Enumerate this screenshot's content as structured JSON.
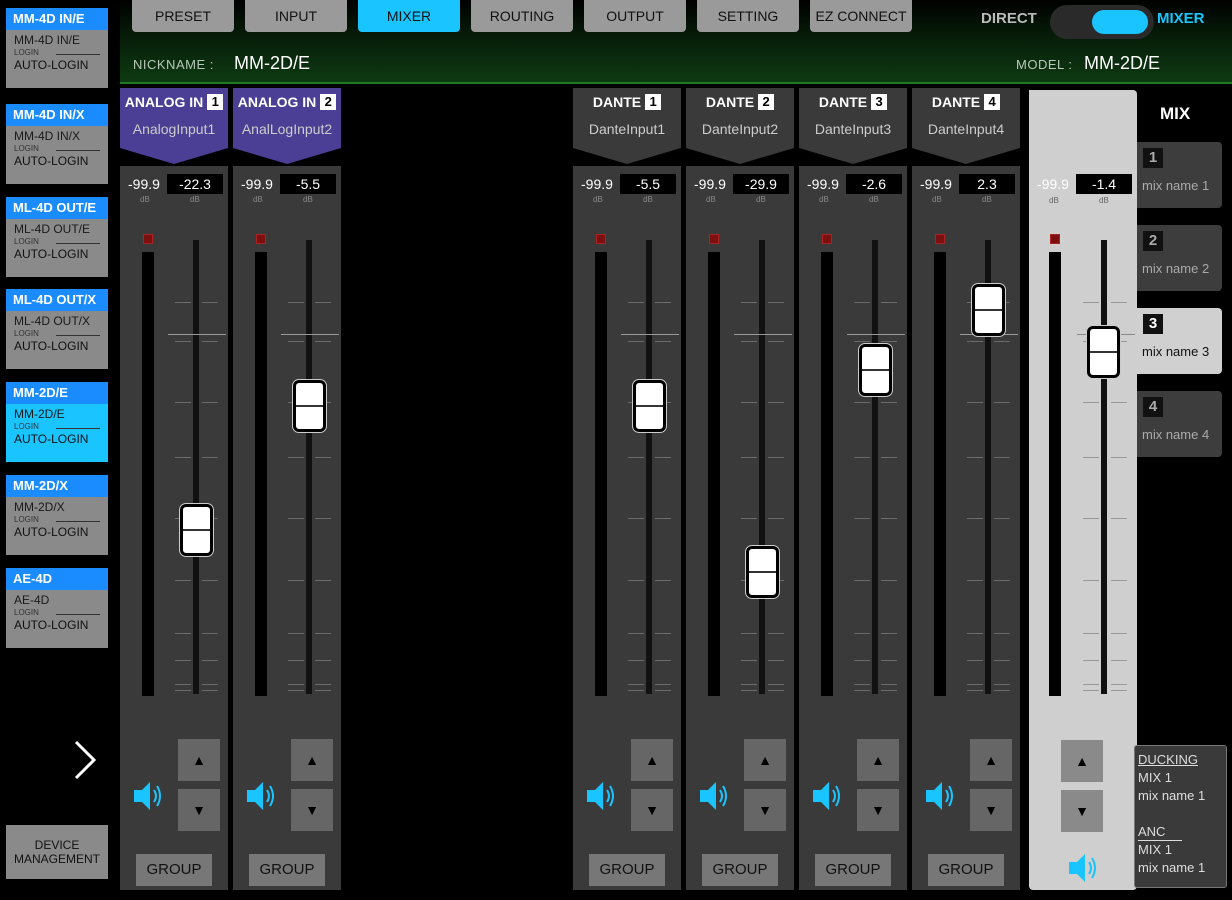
{
  "sidebar": {
    "devices": [
      {
        "title": "MM-4D IN/E",
        "name": "MM-4D IN/E",
        "login": "LOGIN",
        "auto": "AUTO-LOGIN"
      },
      {
        "title": "MM-4D IN/X",
        "name": "MM-4D IN/X",
        "login": "LOGIN",
        "auto": "AUTO-LOGIN"
      },
      {
        "title": "ML-4D OUT/E",
        "name": "ML-4D OUT/E",
        "login": "LOGIN",
        "auto": "AUTO-LOGIN"
      },
      {
        "title": "ML-4D OUT/X",
        "name": "ML-4D OUT/X",
        "login": "LOGIN",
        "auto": "AUTO-LOGIN"
      },
      {
        "title": "MM-2D/E",
        "name": "MM-2D/E",
        "login": "LOGIN",
        "auto": "AUTO-LOGIN"
      },
      {
        "title": "MM-2D/X",
        "name": "MM-2D/X",
        "login": "LOGIN",
        "auto": "AUTO-LOGIN"
      },
      {
        "title": "AE-4D",
        "name": "AE-4D",
        "login": "LOGIN",
        "auto": "AUTO-LOGIN"
      }
    ],
    "next_icon": "chevron-right-icon",
    "device_management": "DEVICE MANAGEMENT"
  },
  "header": {
    "tabs": [
      "PRESET",
      "INPUT",
      "MIXER",
      "ROUTING",
      "OUTPUT",
      "SETTING",
      "EZ CONNECT"
    ],
    "active_tab": "MIXER",
    "toggle_left": "DIRECT",
    "toggle_right": "MIXER",
    "nickname_label": "NICKNAME :",
    "nickname_value": "MM-2D/E",
    "model_label": "MODEL :",
    "model_value": "MM-2D/E"
  },
  "channels": [
    {
      "type": "ANALOG IN",
      "num": "1",
      "name": "AnalogInput1",
      "peak": "-99.9",
      "gain": "-22.3",
      "db": "dB",
      "group": "GROUP"
    },
    {
      "type": "ANALOG IN",
      "num": "2",
      "name": "AnalLogInput2",
      "peak": "-99.9",
      "gain": "-5.5",
      "db": "dB",
      "group": "GROUP"
    },
    {
      "type": "DANTE",
      "num": "1",
      "name": "DanteInput1",
      "peak": "-99.9",
      "gain": "-5.5",
      "db": "dB",
      "group": "GROUP"
    },
    {
      "type": "DANTE",
      "num": "2",
      "name": "DanteInput2",
      "peak": "-99.9",
      "gain": "-29.9",
      "db": "dB",
      "group": "GROUP"
    },
    {
      "type": "DANTE",
      "num": "3",
      "name": "DanteInput3",
      "peak": "-99.9",
      "gain": "-2.6",
      "db": "dB",
      "group": "GROUP"
    },
    {
      "type": "DANTE",
      "num": "4",
      "name": "DanteInput4",
      "peak": "-99.9",
      "gain": "2.3",
      "db": "dB",
      "group": "GROUP"
    }
  ],
  "mix_master": {
    "peak": "-99.9",
    "gain": "-1.4",
    "db": "dB"
  },
  "mix": {
    "title": "MIX",
    "items": [
      {
        "num": "1",
        "name": "mix name 1"
      },
      {
        "num": "2",
        "name": "mix name 2"
      },
      {
        "num": "3",
        "name": "mix name 3"
      },
      {
        "num": "4",
        "name": "mix name 4"
      }
    ],
    "active": "3"
  },
  "ducking": {
    "title": "DUCKING",
    "mix": "MIX 1",
    "mix_name": "mix name 1",
    "anc_title": "ANC",
    "anc_mix": "MIX 1",
    "anc_mix_name": "mix name 1"
  },
  "colors": {
    "accent": "#1ac4ff",
    "analog_header": "#4a3f94",
    "dante_header": "#3a3a3a",
    "header_green": "#0e3a12"
  },
  "icons": {
    "up": "up-arrow-icon",
    "down": "down-arrow-icon",
    "speaker": "speaker-icon",
    "next": "chevron-right-icon"
  }
}
